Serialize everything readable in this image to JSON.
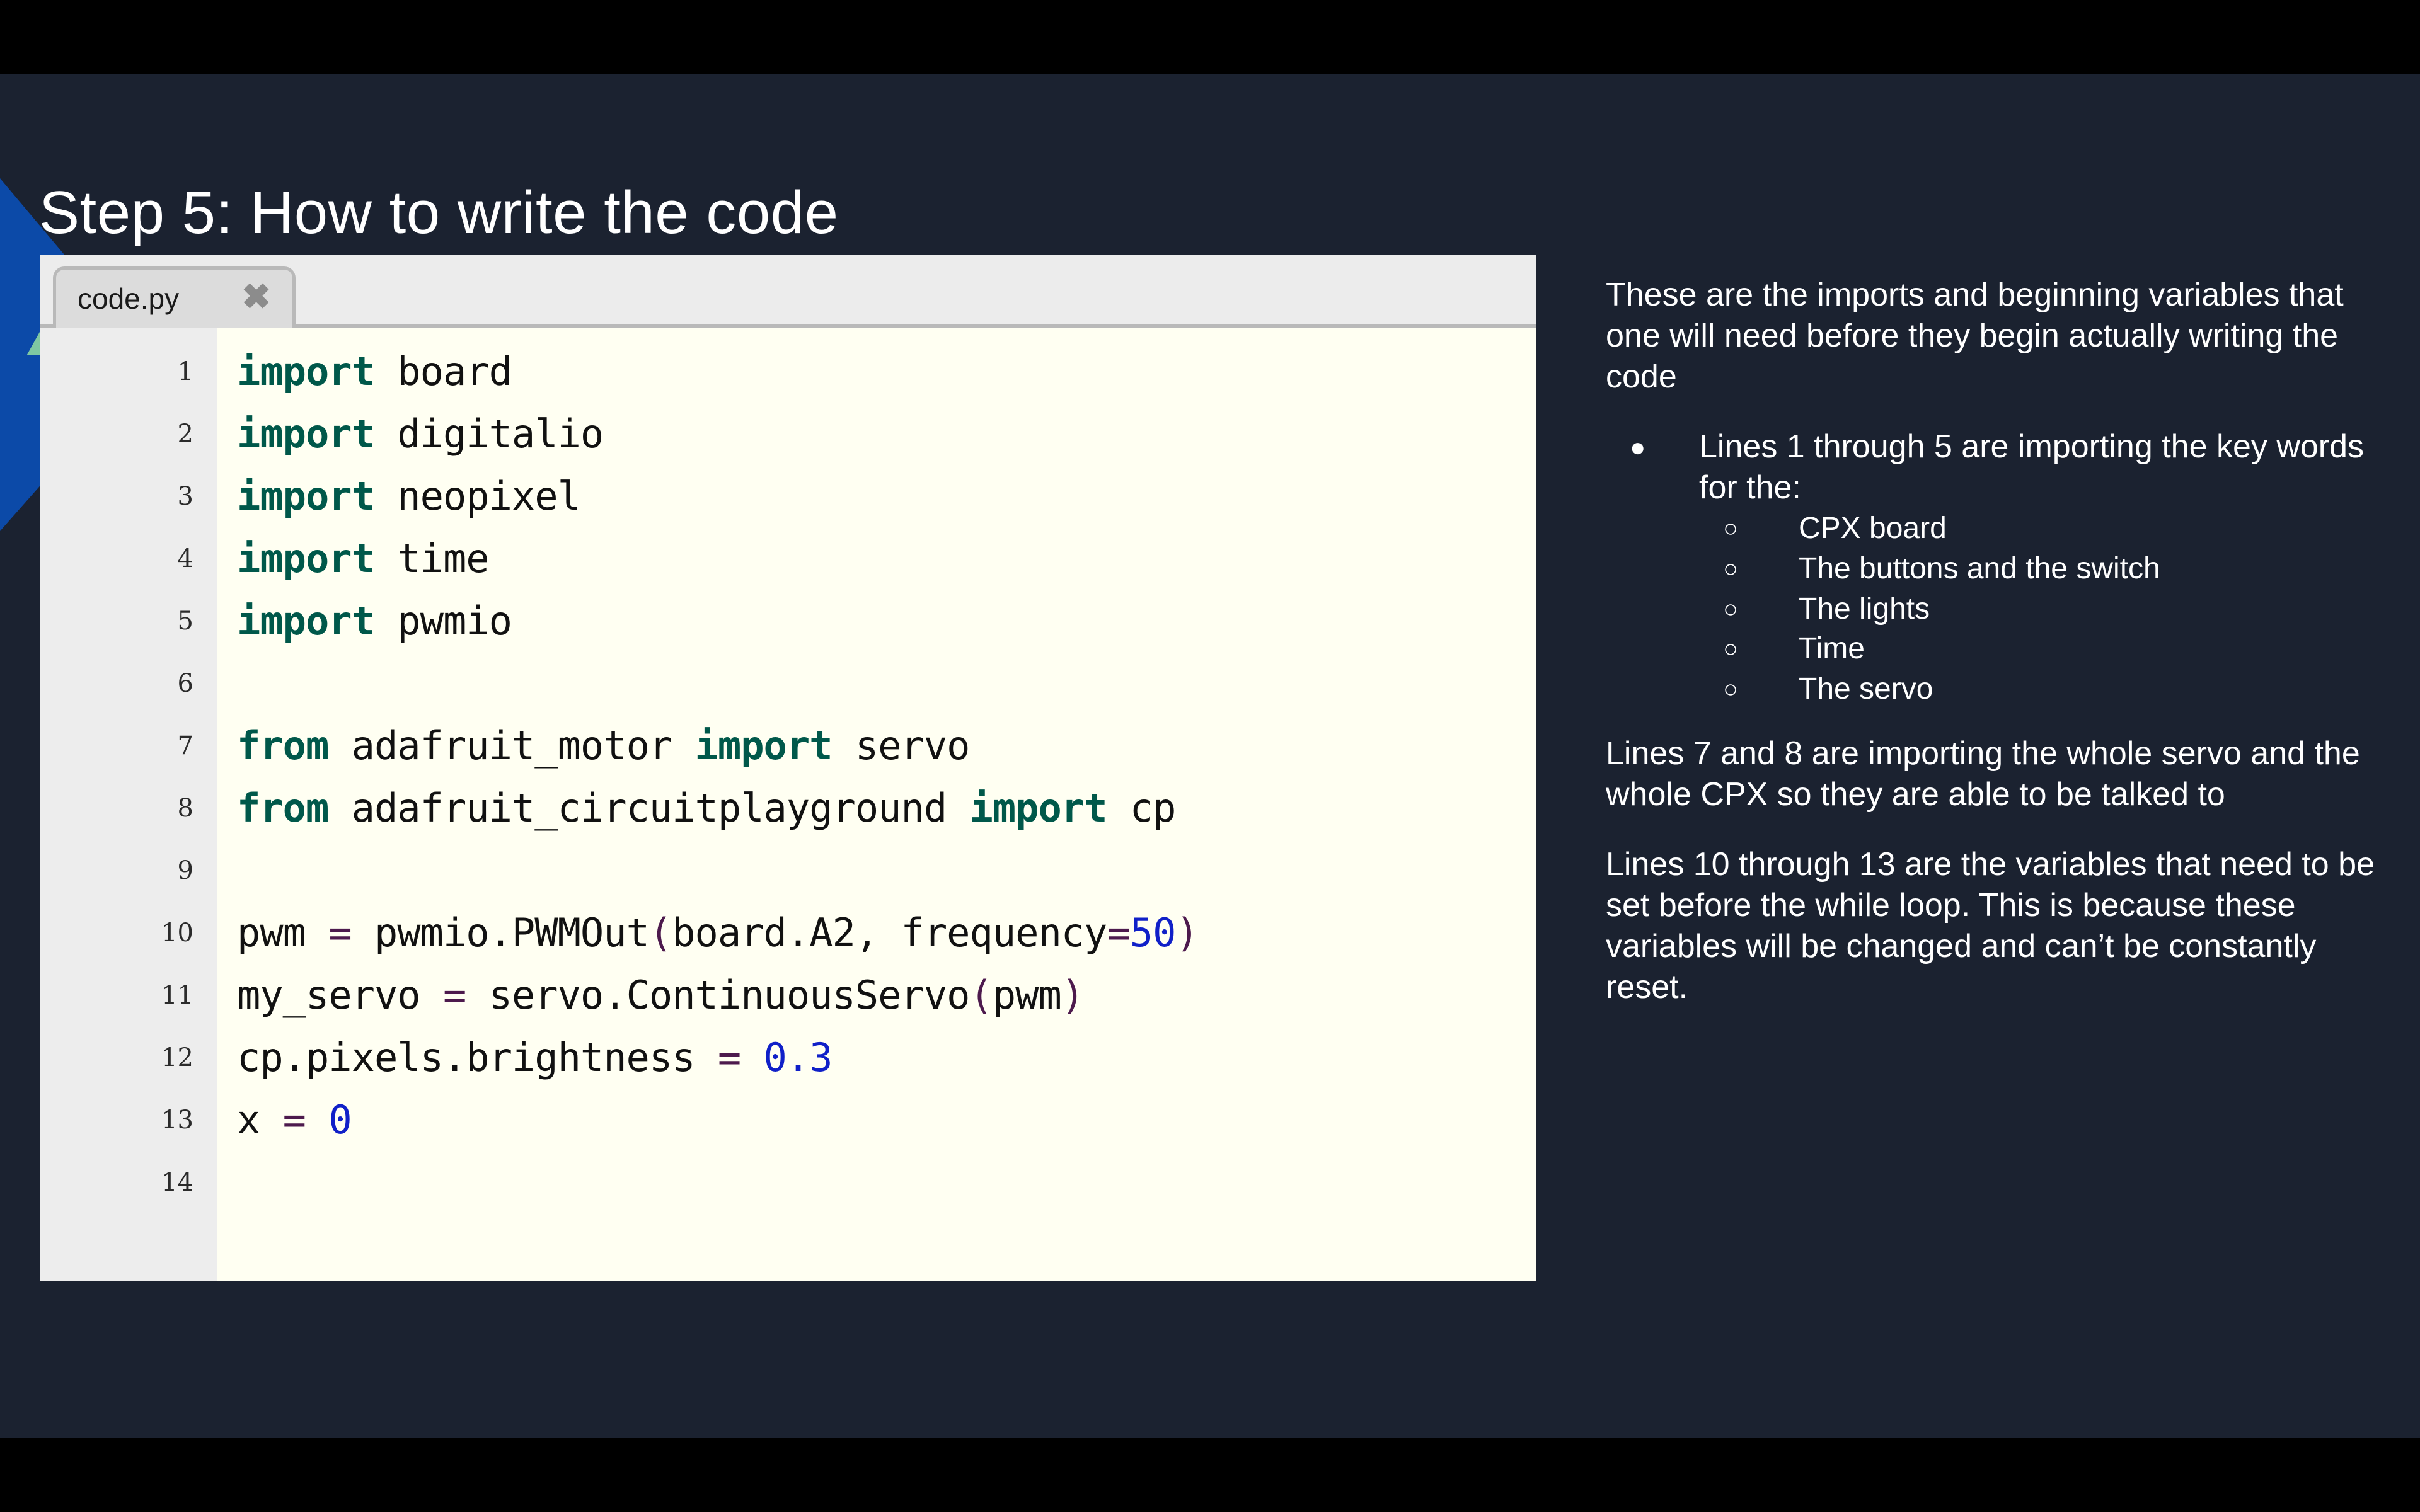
{
  "slide": {
    "title": "Step 5: How to write the code",
    "background_color": "#1b2230",
    "accent_blue": "#0c4aa8",
    "accent_green": "#7fc8a2"
  },
  "editor": {
    "tab_label": "code.py",
    "close_icon": "✖",
    "keyword_color": "#00584a",
    "number_color": "#1020c8",
    "operator_color": "#4d1a4d",
    "lines": [
      {
        "n": "1",
        "tokens": [
          {
            "t": "import",
            "c": "kw"
          },
          {
            "t": " board",
            "c": ""
          }
        ]
      },
      {
        "n": "2",
        "tokens": [
          {
            "t": "import",
            "c": "kw"
          },
          {
            "t": " digitalio",
            "c": ""
          }
        ]
      },
      {
        "n": "3",
        "tokens": [
          {
            "t": "import",
            "c": "kw"
          },
          {
            "t": " neopixel",
            "c": ""
          }
        ]
      },
      {
        "n": "4",
        "tokens": [
          {
            "t": "import",
            "c": "kw"
          },
          {
            "t": " time",
            "c": ""
          }
        ]
      },
      {
        "n": "5",
        "tokens": [
          {
            "t": "import",
            "c": "kw"
          },
          {
            "t": " pwmio",
            "c": ""
          }
        ]
      },
      {
        "n": "6",
        "tokens": []
      },
      {
        "n": "7",
        "tokens": [
          {
            "t": "from",
            "c": "kw"
          },
          {
            "t": " adafruit_motor ",
            "c": ""
          },
          {
            "t": "import",
            "c": "kw"
          },
          {
            "t": " servo",
            "c": ""
          }
        ]
      },
      {
        "n": "8",
        "tokens": [
          {
            "t": "from",
            "c": "kw"
          },
          {
            "t": " adafruit_circuitplayground ",
            "c": ""
          },
          {
            "t": "import",
            "c": "kw"
          },
          {
            "t": " cp",
            "c": ""
          }
        ]
      },
      {
        "n": "9",
        "tokens": []
      },
      {
        "n": "10",
        "tokens": [
          {
            "t": "pwm ",
            "c": ""
          },
          {
            "t": "=",
            "c": "op"
          },
          {
            "t": " pwmio.PWMOut",
            "c": ""
          },
          {
            "t": "(",
            "c": "op"
          },
          {
            "t": "board.A2, frequency",
            "c": ""
          },
          {
            "t": "=",
            "c": "op"
          },
          {
            "t": "50",
            "c": "num"
          },
          {
            "t": ")",
            "c": "op"
          }
        ]
      },
      {
        "n": "11",
        "tokens": [
          {
            "t": "my_servo ",
            "c": ""
          },
          {
            "t": "=",
            "c": "op"
          },
          {
            "t": " servo.ContinuousServo",
            "c": ""
          },
          {
            "t": "(",
            "c": "op"
          },
          {
            "t": "pwm",
            "c": ""
          },
          {
            "t": ")",
            "c": "op"
          }
        ]
      },
      {
        "n": "12",
        "tokens": [
          {
            "t": "cp.pixels.brightness ",
            "c": ""
          },
          {
            "t": "=",
            "c": "op"
          },
          {
            "t": " ",
            "c": ""
          },
          {
            "t": "0.3",
            "c": "num"
          }
        ]
      },
      {
        "n": "13",
        "tokens": [
          {
            "t": "x ",
            "c": ""
          },
          {
            "t": "=",
            "c": "op"
          },
          {
            "t": " ",
            "c": ""
          },
          {
            "t": "0",
            "c": "num"
          }
        ]
      },
      {
        "n": "14",
        "tokens": []
      }
    ]
  },
  "notes": {
    "intro": "These are the imports and beginning variables that one will need before they begin actually writing the code",
    "bullet_glyph": "●",
    "sub_bullet_glyph": "○",
    "bullets": [
      {
        "text": "Lines 1 through 5 are importing the key words for the:",
        "children": [
          "CPX board",
          "The buttons and the switch",
          "The lights",
          "Time",
          "The servo"
        ]
      }
    ],
    "para2": "Lines 7 and 8 are importing the whole servo and the whole CPX so they are able to be talked to",
    "para3": "Lines 10 through 13 are the variables that need to be set before the while loop. This is because these variables will be changed and can’t be constantly reset."
  }
}
